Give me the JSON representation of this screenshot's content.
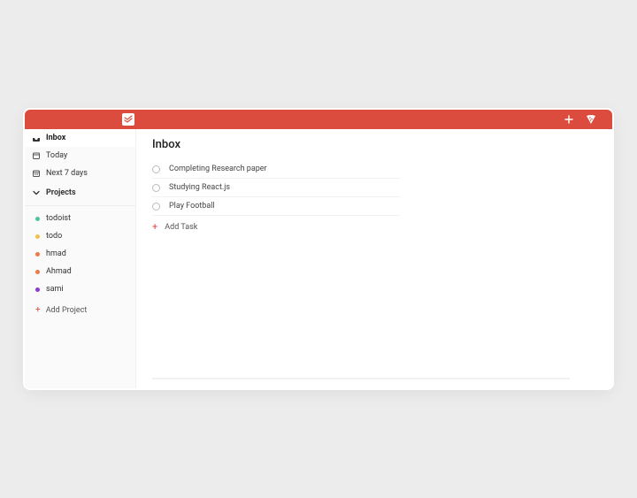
{
  "header": {
    "logo_label": "todoist",
    "quick_add_label": "+",
    "pizza_label": "🍕"
  },
  "sidebar": {
    "inbox_label": "Inbox",
    "today_label": "Today",
    "next7_label": "Next 7 days",
    "projects_header": "Projects",
    "projects": [
      {
        "name": "todoist",
        "color": "#4fc4a4"
      },
      {
        "name": "todo",
        "color": "#f0c04a"
      },
      {
        "name": "hmad",
        "color": "#f07846"
      },
      {
        "name": "Ahmad",
        "color": "#f07846"
      },
      {
        "name": "sami",
        "color": "#8a3bd6"
      }
    ],
    "add_project_label": "Add Project"
  },
  "main": {
    "title": "Inbox",
    "tasks": [
      {
        "title": "Completing Research paper"
      },
      {
        "title": "Studying React.js"
      },
      {
        "title": "Play Football"
      }
    ],
    "add_task_label": "Add Task"
  }
}
